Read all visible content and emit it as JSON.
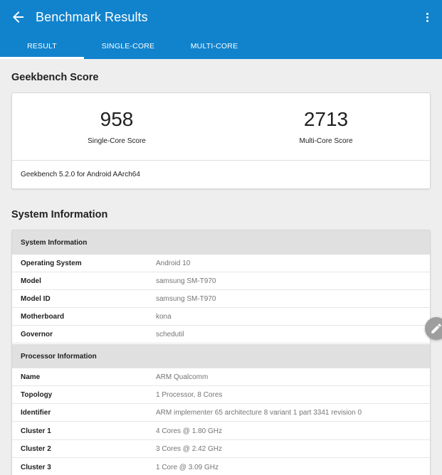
{
  "header": {
    "title": "Benchmark Results",
    "back_icon": "arrow-left-icon",
    "menu_icon": "more-vertical-icon",
    "color": "#1183cd"
  },
  "tabs": [
    {
      "label": "RESULT",
      "active": true
    },
    {
      "label": "SINGLE-CORE",
      "active": false
    },
    {
      "label": "MULTI-CORE",
      "active": false
    }
  ],
  "geekbench": {
    "section_title": "Geekbench Score",
    "single_core_score": "958",
    "single_core_label": "Single-Core Score",
    "multi_core_score": "2713",
    "multi_core_label": "Multi-Core Score",
    "version": "Geekbench 5.2.0 for Android AArch64"
  },
  "system_info": {
    "section_title": "System Information",
    "groups": [
      {
        "title": "System Information",
        "rows": [
          {
            "key": "Operating System",
            "value": "Android 10"
          },
          {
            "key": "Model",
            "value": "samsung SM-T970"
          },
          {
            "key": "Model ID",
            "value": "samsung SM-T970"
          },
          {
            "key": "Motherboard",
            "value": "kona"
          },
          {
            "key": "Governor",
            "value": "schedutil"
          }
        ]
      },
      {
        "title": "Processor Information",
        "rows": [
          {
            "key": "Name",
            "value": "ARM Qualcomm"
          },
          {
            "key": "Topology",
            "value": "1 Processor, 8 Cores"
          },
          {
            "key": "Identifier",
            "value": "ARM implementer 65 architecture 8 variant 1 part 3341 revision 0"
          },
          {
            "key": "Cluster 1",
            "value": "4 Cores @ 1.80 GHz"
          },
          {
            "key": "Cluster 2",
            "value": "3 Cores @ 2.42 GHz"
          },
          {
            "key": "Cluster 3",
            "value": "1 Core @ 3.09 GHz"
          }
        ]
      }
    ]
  },
  "fab": {
    "icon": "pencil-icon"
  }
}
